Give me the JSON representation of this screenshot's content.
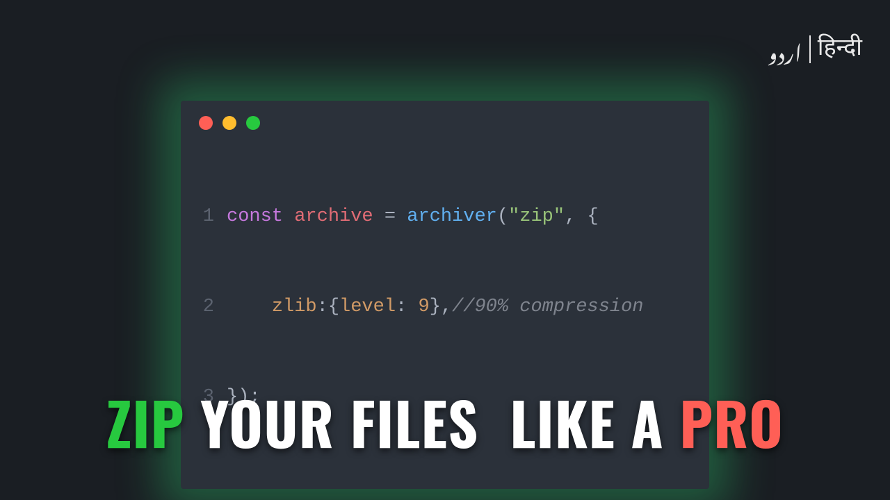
{
  "languages": {
    "urdu": "اردو",
    "hindi": "हिन्दी"
  },
  "colors": {
    "background": "#1a1e23",
    "window_bg": "#2b313a",
    "glow": "#2ecc71",
    "traffic_red": "#ff5f56",
    "traffic_yellow": "#ffbd2e",
    "traffic_green": "#27c93f",
    "headline_zip": "#27c93f",
    "headline_pro": "#ff5f56"
  },
  "code": {
    "lines": [
      "1",
      "2",
      "3"
    ],
    "l1": {
      "kw": "const",
      "var": "archive",
      "eq": " = ",
      "fn": "archiver",
      "open": "(",
      "str": "\"zip\"",
      "comma": ", {"
    },
    "l2": {
      "indent": "    ",
      "prop": "zlib",
      "colon": ":{",
      "prop2": "level",
      "colon2": ": ",
      "num": "9",
      "close": "},",
      "cmt": "//90% compression"
    },
    "l3": {
      "close": "});"
    }
  },
  "headline": {
    "w1": "ZIP",
    "w2": "YOUR FILES",
    "w3": "LIKE A",
    "w4": "PRO"
  }
}
